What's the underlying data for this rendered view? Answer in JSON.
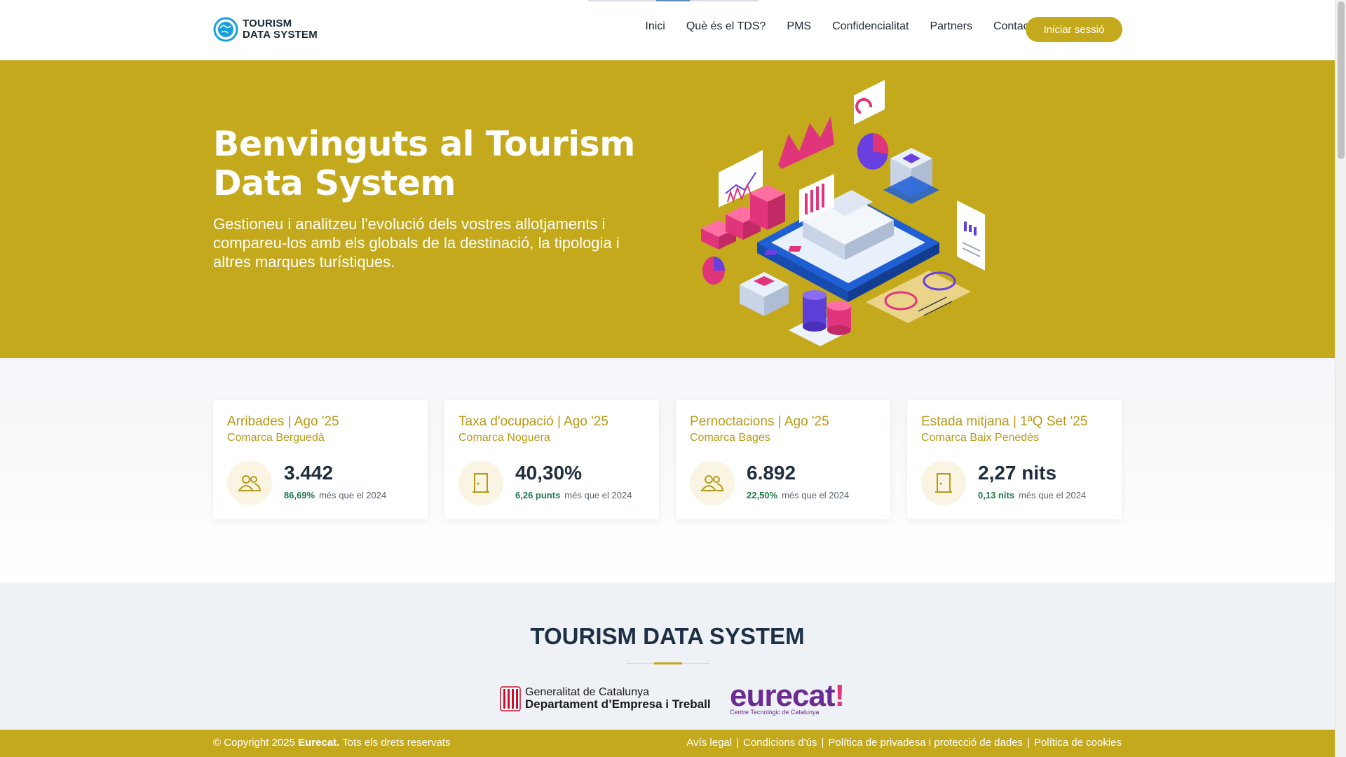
{
  "header": {
    "brand_line1": "TOURISM",
    "brand_line2": "DATA SYSTEM",
    "nav": [
      "Inici",
      "Què és el TDS?",
      "PMS",
      "Confidencialitat",
      "Partners",
      "Contacte"
    ],
    "login_label": "Iniciar sessió"
  },
  "hero": {
    "title": "Benvinguts al Tourism Data System",
    "subtitle": "Gestioneu i analitzeu l'evolució dels vostres allotjaments i compareu-los amb els globals de la destinació, la tipologia i altres marques turístiques."
  },
  "stats": [
    {
      "title": "Arribades | Ago '25",
      "subtitle": "Comarca Berguedà",
      "value": "3.442",
      "delta": "86,69%",
      "delta_text": "més que el 2024",
      "icon": "people-icon"
    },
    {
      "title": "Taxa d'ocupació | Ago '25",
      "subtitle": "Comarca Noguera",
      "value": "40,30%",
      "delta": "6,26 punts",
      "delta_text": "més que el 2024",
      "icon": "door-icon"
    },
    {
      "title": "Pernoctacions | Ago '25",
      "subtitle": "Comarca Bages",
      "value": "6.892",
      "delta": "22,50%",
      "delta_text": "més que el 2024",
      "icon": "people-icon"
    },
    {
      "title": "Estada mitjana | 1ªQ Set '25",
      "subtitle": "Comarca Baix Penedès",
      "value": "2,27 nits",
      "delta": "0,13 nits",
      "delta_text": "més que el 2024",
      "icon": "door-icon"
    }
  ],
  "partners": {
    "title": "TOURISM DATA SYSTEM",
    "gencat_line1": "Generalitat de Catalunya",
    "gencat_line2": "Departament d’Empresa i Treball",
    "eurecat_name": "eurecat",
    "eurecat_tag": "Centre Tecnològic de Catalunya"
  },
  "footer": {
    "copy_prefix": "© Copyright 2025",
    "copy_brand": "Eurecat.",
    "copy_suffix": "Tots els drets reservats",
    "links": [
      "Avís legal",
      "Condicions d'ús",
      "Política de privadesa i protecció de dades",
      "Política de cookies"
    ]
  },
  "colors": {
    "accent": "#c4a91c",
    "card_title": "#b99a17",
    "positive": "#1e7a4a",
    "dark": "#1d2f45"
  }
}
